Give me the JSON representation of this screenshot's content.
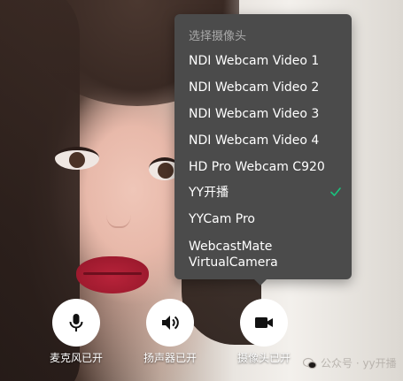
{
  "camera_menu": {
    "title": "选择摄像头",
    "items": [
      {
        "label": "NDI Webcam Video 1",
        "selected": false
      },
      {
        "label": "NDI Webcam Video 2",
        "selected": false
      },
      {
        "label": "NDI Webcam Video 3",
        "selected": false
      },
      {
        "label": "NDI Webcam Video 4",
        "selected": false
      },
      {
        "label": "HD Pro Webcam C920",
        "selected": false
      },
      {
        "label": "YY开播",
        "selected": true
      },
      {
        "label": "YYCam Pro",
        "selected": false
      },
      {
        "label": "WebcastMate\nVirtualCamera",
        "selected": false
      }
    ],
    "check_color": "#19c27c"
  },
  "controls": {
    "microphone": {
      "label": "麦克风已开",
      "icon": "microphone-icon"
    },
    "speaker": {
      "label": "扬声器已开",
      "icon": "speaker-icon"
    },
    "camera": {
      "label": "摄像头已开",
      "icon": "video-camera-icon"
    }
  },
  "watermark": {
    "text": "公众号 · yy开播",
    "icon": "wechat-icon"
  }
}
